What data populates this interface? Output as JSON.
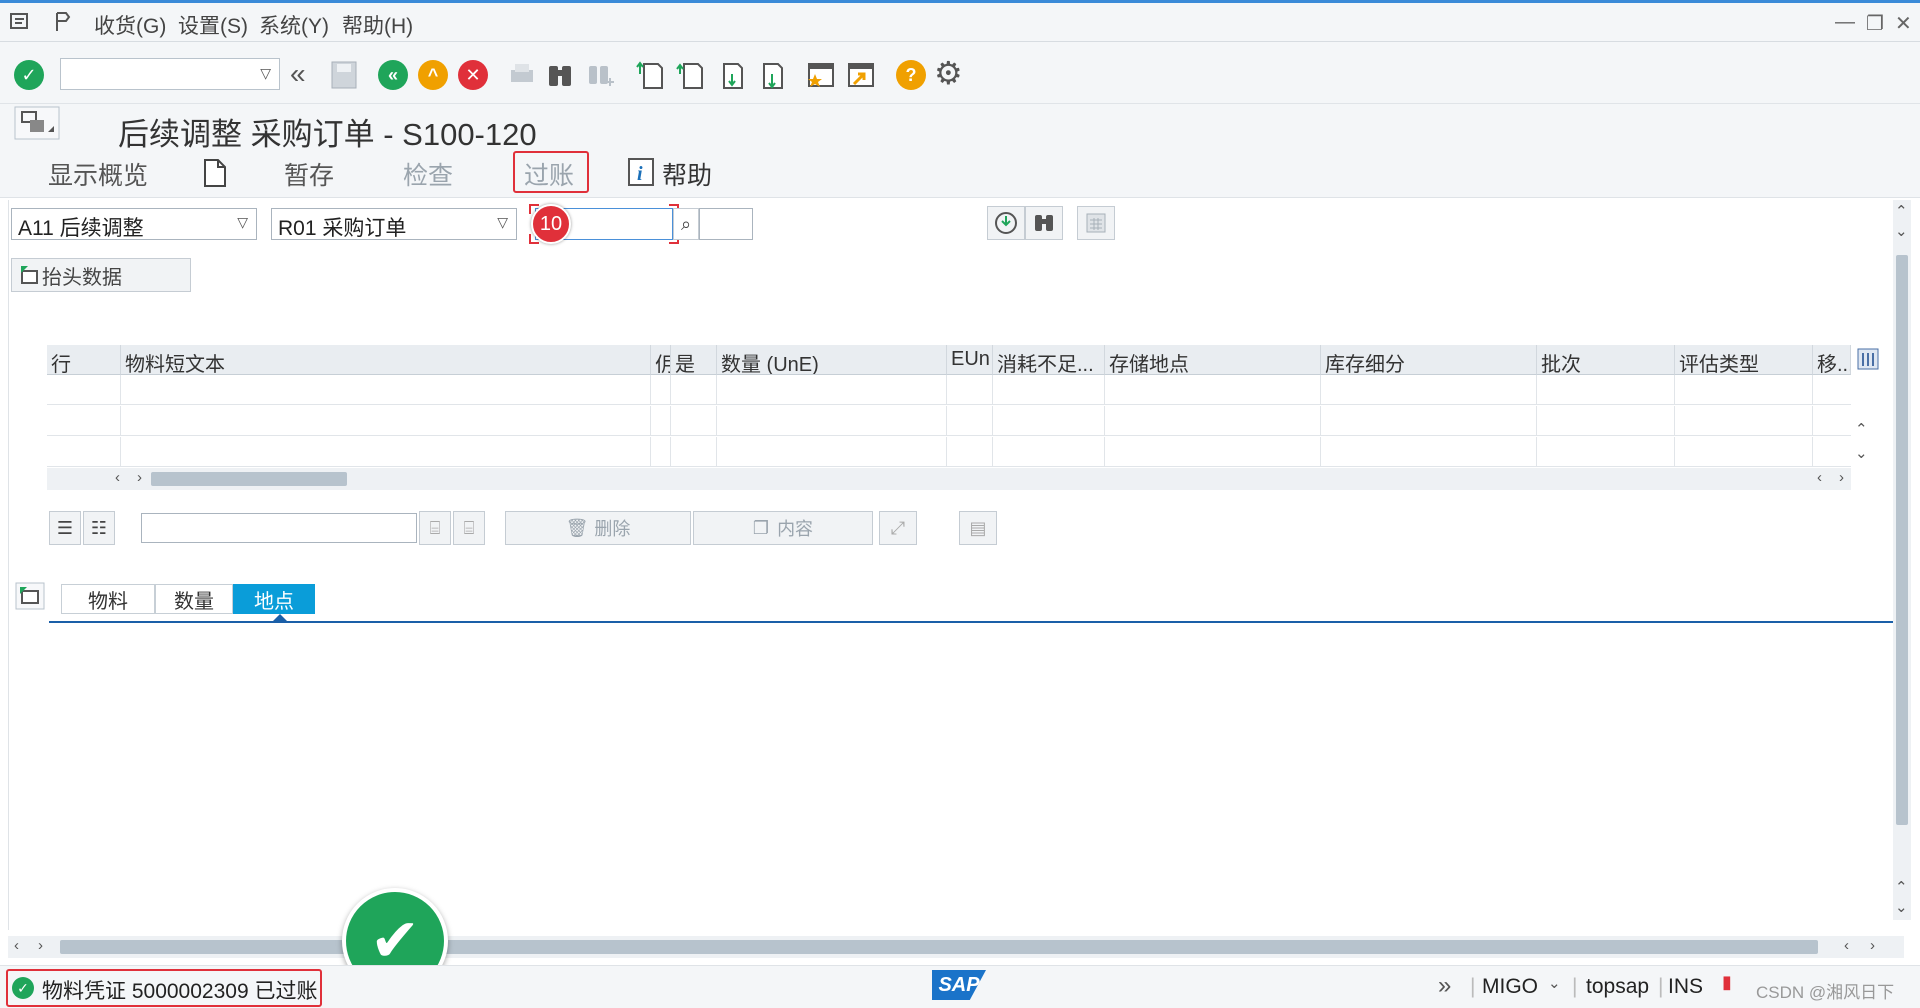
{
  "menu": {
    "items": [
      "收货(G)",
      "设置(S)",
      "系统(Y)",
      "帮助(H)"
    ]
  },
  "title": "后续调整 采购订单 - S100-120",
  "app_toolbar": {
    "overview": "显示概览",
    "hold": "暂存",
    "check": "检查",
    "post": "过账",
    "help": "帮助"
  },
  "selection": {
    "action": "A11 后续调整",
    "reference": "R01 采购订单",
    "po_number": "",
    "step_badge": "10"
  },
  "header_data_button": "抬头数据",
  "grid": {
    "columns": [
      "行",
      "物料短文本",
      "仴",
      "是",
      "数量 (UnE)",
      "EUn",
      "消耗不足...",
      "存储地点",
      "库存细分",
      "批次",
      "评估类型",
      "移..."
    ],
    "empty_rows": 3
  },
  "grid_toolbar": {
    "delete": "删除",
    "content": "内容"
  },
  "tabs": [
    {
      "label": "物料",
      "active": false
    },
    {
      "label": "数量",
      "active": false
    },
    {
      "label": "地点",
      "active": true
    }
  ],
  "status": {
    "message": "物料凭证 5000002309 已过账",
    "transaction": "MIGO",
    "system": "topsap",
    "mode": "INS",
    "logo": "SAP",
    "watermark": "CSDN @湘风日下"
  },
  "colors": {
    "accent": "#0a9dd9",
    "highlight": "#e0303a",
    "success": "#1fa55a"
  }
}
